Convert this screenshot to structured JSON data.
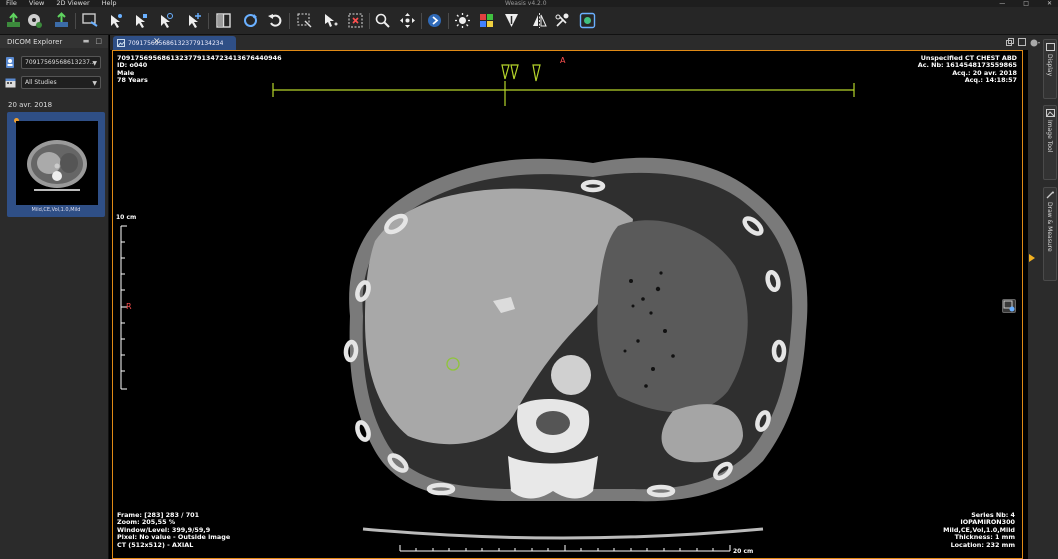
{
  "app": {
    "title": "Weasis v4.2.0",
    "menu": [
      "File",
      "View",
      "2D Viewer",
      "Help"
    ]
  },
  "left_panel": {
    "title": "DICOM Explorer",
    "patient_combo": "70917569568613237...",
    "studies_combo": "All Studies",
    "study_date": "20 avr. 2018",
    "series_label": "Mild,CE,Vol,1.0,Mild"
  },
  "tab": {
    "title": "709175695686132377913423416764409..."
  },
  "overlay": {
    "top_left": [
      "709175695686132377913472341367644094​6",
      "ID: o040",
      "Male",
      "78 Years"
    ],
    "top_right": [
      "Unspecified CT CHEST ABD",
      "Ac. Nb: 1614548173559865",
      "Acq.: 20 avr. 2018",
      "Acq.: 14:18:57"
    ],
    "bottom_left": [
      "Frame: [283] 283 / 701",
      "Zoom: 205,55 %",
      "Window/Level: 399,9/59,9",
      "Pixel: No value - Outside image",
      "CT (512x512) - AXIAL"
    ],
    "bottom_right": [
      "Series Nb: 4",
      "IOPAMIRON300",
      "Mild,CE,Vol,1.0,Mild",
      "Thickness: 1 mm",
      "Location: 232 mm"
    ],
    "orientation_top": "A",
    "orientation_left": "R",
    "vertical_scale": "10 cm",
    "horizontal_scale": "20 cm"
  },
  "right_dock": {
    "tabs": [
      "Display",
      "Image Tool",
      "Draw & Measure"
    ]
  },
  "colors": {
    "accent_border": "#e08a16",
    "tab_selected": "#2f4f86",
    "orientation": "#ff5050",
    "reference_lines": "#b5d42a"
  }
}
